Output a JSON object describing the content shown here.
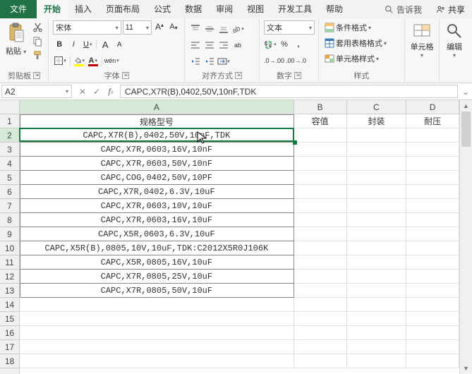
{
  "tabs": {
    "file": "文件",
    "items": [
      "开始",
      "插入",
      "页面布局",
      "公式",
      "数据",
      "审阅",
      "视图",
      "开发工具",
      "帮助"
    ],
    "active_index": 0,
    "tellme_placeholder": "告诉我",
    "share": "共享"
  },
  "ribbon": {
    "clipboard": {
      "paste": "粘贴",
      "label": "剪贴板"
    },
    "font": {
      "name": "宋体",
      "size": "11",
      "bold": "B",
      "italic": "I",
      "underline": "U",
      "ruby": "wén",
      "fill_color": "#ffff00",
      "font_color": "#c00000",
      "label": "字体"
    },
    "align": {
      "wrap": "ab",
      "label": "对齐方式"
    },
    "number": {
      "format": "文本",
      "label": "数字"
    },
    "styles": {
      "cond": "条件格式",
      "tablefmt": "套用表格格式",
      "cellstyle": "单元格样式",
      "label": "样式"
    },
    "cells": {
      "label": "单元格"
    },
    "editing": {
      "label": "编辑"
    }
  },
  "formula_bar": {
    "name_box": "A2",
    "formula": "CAPC,X7R(B),0402,50V,10nF,TDK"
  },
  "grid": {
    "col_widths": {
      "A": 390,
      "B": 75,
      "C": 85,
      "D": 75
    },
    "columns": [
      "A",
      "B",
      "C",
      "D"
    ],
    "headers": {
      "A": "规格型号",
      "B": "容值",
      "C": "封装",
      "D": "耐压"
    },
    "rows": 18,
    "data": [
      "CAPC,X7R(B),0402,50V,10nF,TDK",
      "CAPC,X7R,0603,16V,10nF",
      "CAPC,X7R,0603,50V,10nF",
      "CAPC,COG,0402,50V,10PF",
      "CAPC,X7R,0402,6.3V,10uF",
      "CAPC,X7R,0603,10V,10uF",
      "CAPC,X7R,0603,16V,10uF",
      "CAPC,X5R,0603,6.3V,10uF",
      "CAPC,X5R(B),0805,10V,10uF,TDK:C2012X5R0J106K",
      "CAPC,X5R,0805,16V,10uF",
      "CAPC,X7R,0805,25V,10uF",
      "CAPC,X7R,0805,50V,10uF"
    ],
    "selected_cell": "A2"
  }
}
